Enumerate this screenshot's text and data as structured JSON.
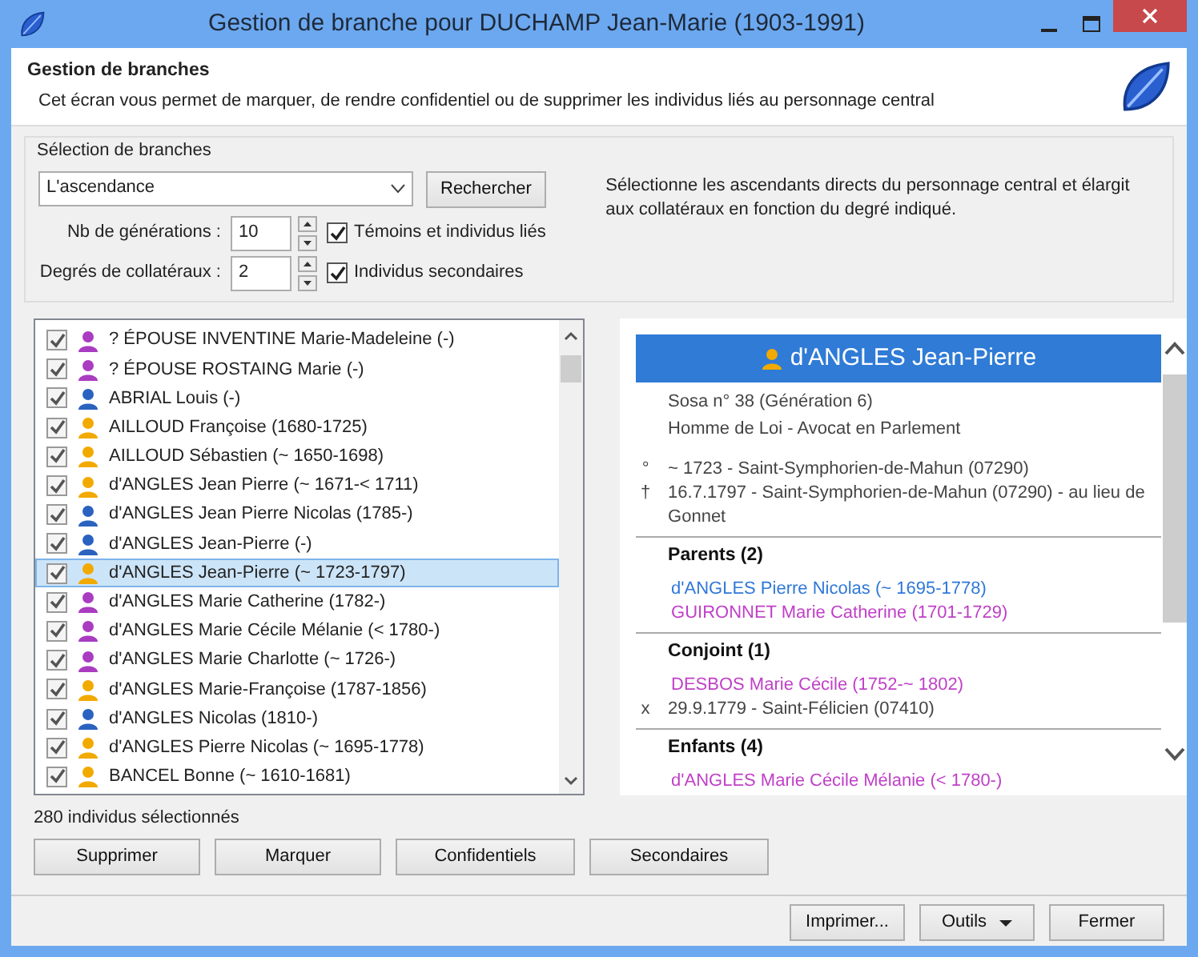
{
  "window": {
    "title": "Gestion de branche pour DUCHAMP Jean-Marie (1903-1991)"
  },
  "header": {
    "title": "Gestion de branches",
    "description": "Cet écran vous permet de marquer, de rendre confidentiel ou de supprimer les individus liés au personnage central"
  },
  "selection": {
    "legend": "Sélection de branches",
    "branch_select": {
      "value": "L'ascendance"
    },
    "search_button": "Rechercher",
    "generations": {
      "label": "Nb de générations :",
      "value": "10"
    },
    "collaterals": {
      "label": "Degrés de collatéraux :",
      "value": "2"
    },
    "options": [
      {
        "label": "Témoins et individus liés",
        "checked": true
      },
      {
        "label": "Individus secondaires",
        "checked": true
      }
    ],
    "help_text": "Sélectionne les ascendants directs du personnage central et élargit aux collatéraux en fonction du degré indiqué."
  },
  "individuals": [
    {
      "name": "? ÉPOUSE INVENTINE Marie-Madeleine (-)",
      "checked": true,
      "selected": false,
      "color": "#a93cc0"
    },
    {
      "name": "? ÉPOUSE ROSTAING Marie (-)",
      "checked": true,
      "selected": false,
      "color": "#a93cc0"
    },
    {
      "name": "ABRIAL Louis (-)",
      "checked": true,
      "selected": false,
      "color": "#2a62c0"
    },
    {
      "name": "AILLOUD Françoise (1680-1725)",
      "checked": true,
      "selected": false,
      "color": "#f2a900"
    },
    {
      "name": "AILLOUD Sébastien (~ 1650-1698)",
      "checked": true,
      "selected": false,
      "color": "#f2a900"
    },
    {
      "name": "d'ANGLES Jean Pierre (~ 1671-< 1711)",
      "checked": true,
      "selected": false,
      "color": "#f2a900"
    },
    {
      "name": "d'ANGLES Jean Pierre Nicolas (1785-)",
      "checked": true,
      "selected": false,
      "color": "#2a62c0"
    },
    {
      "name": "d'ANGLES Jean-Pierre (-)",
      "checked": true,
      "selected": false,
      "color": "#2a62c0"
    },
    {
      "name": "d'ANGLES Jean-Pierre (~ 1723-1797)",
      "checked": true,
      "selected": true,
      "color": "#f2a900"
    },
    {
      "name": "d'ANGLES Marie Catherine (1782-)",
      "checked": true,
      "selected": false,
      "color": "#a93cc0"
    },
    {
      "name": "d'ANGLES Marie Cécile Mélanie (< 1780-)",
      "checked": true,
      "selected": false,
      "color": "#a93cc0"
    },
    {
      "name": "d'ANGLES Marie Charlotte (~ 1726-)",
      "checked": true,
      "selected": false,
      "color": "#a93cc0"
    },
    {
      "name": "d'ANGLES Marie-Françoise (1787-1856)",
      "checked": true,
      "selected": false,
      "color": "#f2a900"
    },
    {
      "name": "d'ANGLES Nicolas (1810-)",
      "checked": true,
      "selected": false,
      "color": "#2a62c0"
    },
    {
      "name": "d'ANGLES Pierre Nicolas (~ 1695-1778)",
      "checked": true,
      "selected": false,
      "color": "#f2a900"
    },
    {
      "name": "BANCEL Bonne (~ 1610-1681)",
      "checked": true,
      "selected": false,
      "color": "#f2a900"
    }
  ],
  "detail": {
    "name": "d'ANGLES Jean-Pierre",
    "color": "#f2a900",
    "lines": [
      "Sosa n° 38 (Génération 6)",
      "Homme de Loi - Avocat en Parlement"
    ],
    "events": [
      {
        "symbol": "°",
        "text": "~ 1723 - Saint-Symphorien-de-Mahun (07290)"
      },
      {
        "symbol": "†",
        "text": "16.7.1797 - Saint-Symphorien-de-Mahun (07290) - au lieu de Gonnet"
      }
    ],
    "sections": [
      {
        "title": "Parents (2)",
        "items": [
          {
            "kind": "person",
            "text": "d'ANGLES Pierre Nicolas (~ 1695-1778)",
            "color": "#2f78d8"
          },
          {
            "kind": "person",
            "text": "GUIRONNET Marie Catherine (1701-1729)",
            "color": "#c040c8"
          }
        ]
      },
      {
        "title": "Conjoint (1)",
        "items": [
          {
            "kind": "person",
            "text": "DESBOS Marie Cécile (1752-~ 1802)",
            "color": "#c040c8"
          },
          {
            "kind": "event",
            "symbol": "x",
            "text": "29.9.1779 - Saint-Félicien (07410)"
          }
        ]
      },
      {
        "title": "Enfants (4)",
        "items": [
          {
            "kind": "person",
            "text": "d'ANGLES Marie Cécile Mélanie (< 1780-)",
            "color": "#c040c8"
          }
        ]
      }
    ]
  },
  "status": "280 individus sélectionnés",
  "actions": [
    "Supprimer",
    "Marquer",
    "Confidentiels",
    "Secondaires"
  ],
  "footer_buttons": [
    {
      "label": "Imprimer...",
      "kind": "plain"
    },
    {
      "label": "Outils",
      "kind": "dropdown"
    },
    {
      "label": "Fermer",
      "kind": "plain"
    }
  ]
}
